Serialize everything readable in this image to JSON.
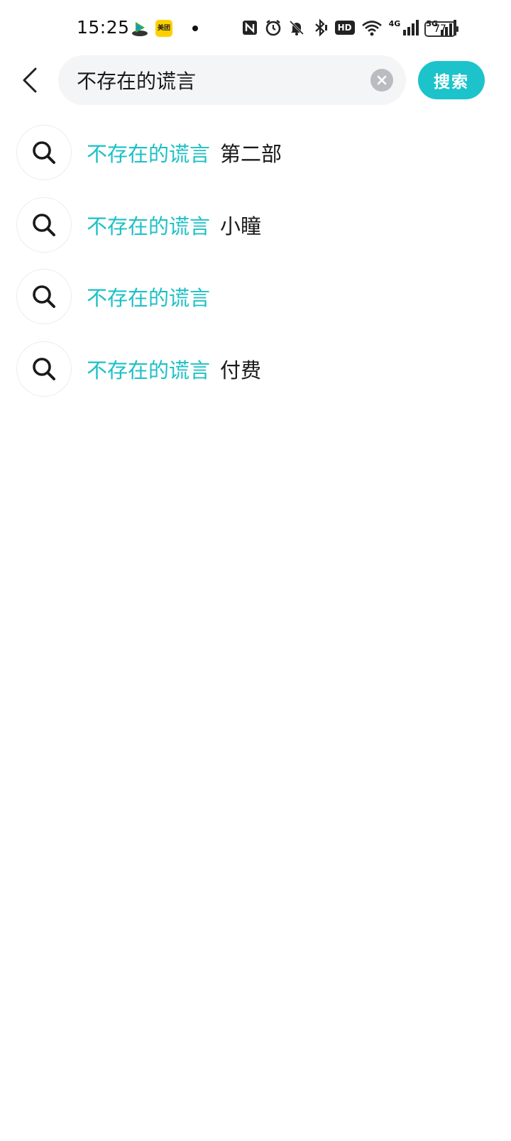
{
  "status_bar": {
    "time": "15:25",
    "meituan_label": "美团",
    "hd_label": "HD",
    "net_4g": "4G",
    "net_5g": "5G",
    "battery": "77"
  },
  "search": {
    "query": "不存在的谎言",
    "button_label": "搜索"
  },
  "suggestions": [
    {
      "highlight": "不存在的谎言",
      "rest": "第二部"
    },
    {
      "highlight": "不存在的谎言",
      "rest": "小瞳"
    },
    {
      "highlight": "不存在的谎言",
      "rest": ""
    },
    {
      "highlight": "不存在的谎言",
      "rest": "付费"
    }
  ],
  "colors": {
    "accent": "#1cc3ca",
    "highlight_text": "#1ec0c6",
    "search_box_bg": "#f4f5f7"
  }
}
